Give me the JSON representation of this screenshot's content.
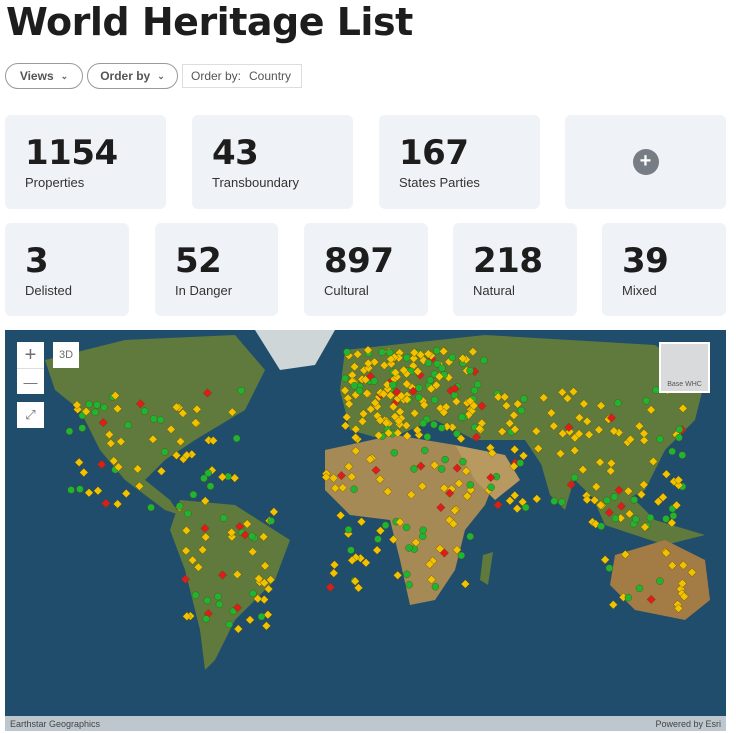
{
  "title": "World Heritage List",
  "toolbar": {
    "views_label": "Views",
    "orderby_label": "Order by",
    "order_prefix": "Order by:",
    "order_value": "Country"
  },
  "stats_row1": [
    {
      "value": "1154",
      "label": "Properties"
    },
    {
      "value": "43",
      "label": "Transboundary"
    },
    {
      "value": "167",
      "label": "States Parties"
    }
  ],
  "add_label": "+",
  "stats_row2": [
    {
      "value": "3",
      "label": "Delisted"
    },
    {
      "value": "52",
      "label": "In Danger"
    },
    {
      "value": "897",
      "label": "Cultural"
    },
    {
      "value": "218",
      "label": "Natural"
    },
    {
      "value": "39",
      "label": "Mixed"
    }
  ],
  "map": {
    "zoom_in": "+",
    "zoom_out": "—",
    "view_3d": "3D",
    "basemap_label": "Base WHC",
    "attribution_left": "Earthstar Geographics",
    "attribution_right": "Powered by Esri",
    "colors": {
      "cultural": "#f2c200",
      "natural": "#1fb534",
      "danger": "#e01b1b",
      "ocean": "#1f4d6b"
    }
  }
}
